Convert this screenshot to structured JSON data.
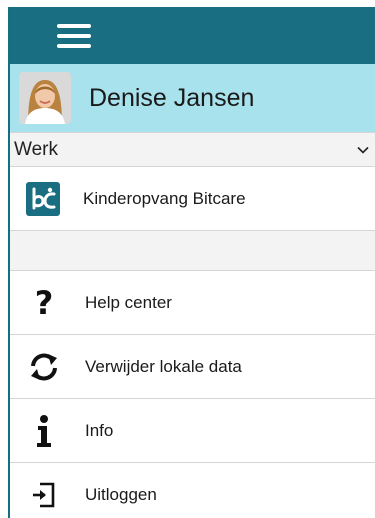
{
  "topbar": {
    "menu_icon": "hamburger-icon"
  },
  "profile": {
    "name": "Denise Jansen",
    "avatar_icon": "user-avatar"
  },
  "section": {
    "label": "Werk",
    "icon": "chevron-down-icon"
  },
  "organization": {
    "name": "Kinderopvang Bitcare",
    "logo_text": "bc",
    "logo_color": "#1a6e81"
  },
  "menu": {
    "items": [
      {
        "label": "Help center",
        "icon": "question-icon"
      },
      {
        "label": "Verwijder lokale data",
        "icon": "refresh-icon"
      },
      {
        "label": "Info",
        "icon": "info-icon"
      },
      {
        "label": "Uitloggen",
        "icon": "logout-icon"
      }
    ]
  },
  "colors": {
    "topbar": "#1a6e81",
    "profile_bg": "#a8e2ed",
    "accent": "#137081"
  }
}
